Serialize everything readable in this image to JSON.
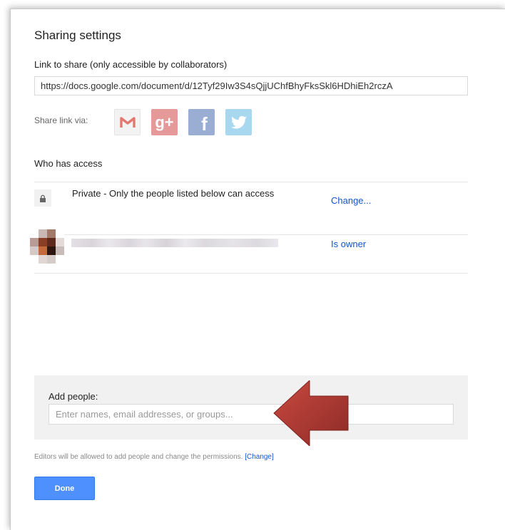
{
  "dialog": {
    "title": "Sharing settings"
  },
  "link": {
    "label": "Link to share (only accessible by collaborators)",
    "url": "https://docs.google.com/document/d/12Tyf29Iw3S4sQjjUChfBhyFksSkl6HDhiEh2rczA"
  },
  "share_via": {
    "label": "Share link via:",
    "services": [
      {
        "name": "gmail",
        "icon": "gmail-icon",
        "glyph": "M",
        "color": "#dd4b39"
      },
      {
        "name": "google-plus",
        "icon": "google-plus-icon",
        "glyph": "g+",
        "color": "#e69999"
      },
      {
        "name": "facebook",
        "icon": "facebook-icon",
        "glyph": "f",
        "color": "#9aaed4"
      },
      {
        "name": "twitter",
        "icon": "twitter-icon",
        "glyph": "",
        "color": "#a8d7f0"
      }
    ]
  },
  "access": {
    "title": "Who has access",
    "visibility_text": "Private - Only the people listed below can access",
    "change_link": "Change...",
    "owner_role": "Is owner"
  },
  "add_people": {
    "label": "Add people:",
    "placeholder": "Enter names, email addresses, or groups..."
  },
  "footer": {
    "note": "Editors will be allowed to add people and change the permissions.",
    "change_link": "[Change]",
    "done_label": "Done"
  },
  "colors": {
    "accent": "#4d90fe",
    "link": "#1155cc",
    "annotation_arrow": "#b03a32"
  }
}
